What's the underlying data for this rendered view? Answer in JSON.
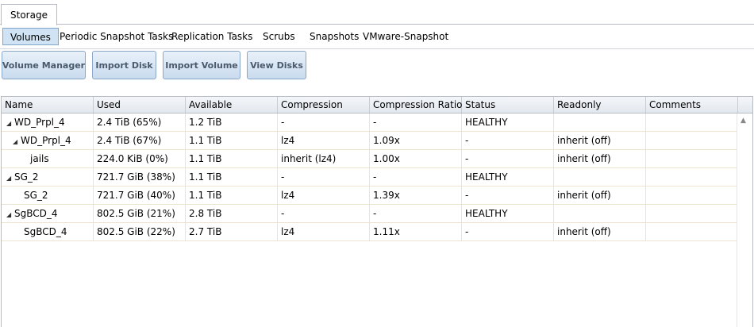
{
  "top_tab": "Storage",
  "subtabs": [
    "Volumes",
    "Periodic Snapshot Tasks",
    "Replication Tasks",
    "Scrubs",
    "Snapshots",
    "VMware-Snapshot"
  ],
  "buttons": [
    "Volume Manager",
    "Import Disk",
    "Import Volume",
    "View Disks"
  ],
  "columns": [
    "Name",
    "Used",
    "Available",
    "Compression",
    "Compression Ratio",
    "Status",
    "Readonly",
    "Comments"
  ],
  "rows": [
    {
      "name": "WD_Prpl_4",
      "used": "2.4 TiB (65%)",
      "available": "1.2 TiB",
      "compression": "-",
      "ratio": "-",
      "status": "HEALTHY",
      "readonly": "",
      "comments": ""
    },
    {
      "name": "WD_Prpl_4",
      "used": "2.4 TiB (67%)",
      "available": "1.1 TiB",
      "compression": "lz4",
      "ratio": "1.09x",
      "status": "-",
      "readonly": "inherit (off)",
      "comments": ""
    },
    {
      "name": "jails",
      "used": "224.0 KiB (0%)",
      "available": "1.1 TiB",
      "compression": "inherit (lz4)",
      "ratio": "1.00x",
      "status": "-",
      "readonly": "inherit (off)",
      "comments": ""
    },
    {
      "name": "SG_2",
      "used": "721.7 GiB (38%)",
      "available": "1.1 TiB",
      "compression": "-",
      "ratio": "-",
      "status": "HEALTHY",
      "readonly": "",
      "comments": ""
    },
    {
      "name": "SG_2",
      "used": "721.7 GiB (40%)",
      "available": "1.1 TiB",
      "compression": "lz4",
      "ratio": "1.39x",
      "status": "-",
      "readonly": "inherit (off)",
      "comments": ""
    },
    {
      "name": "SgBCD_4",
      "used": "802.5 GiB (21%)",
      "available": "2.8 TiB",
      "compression": "-",
      "ratio": "-",
      "status": "HEALTHY",
      "readonly": "",
      "comments": ""
    },
    {
      "name": "SgBCD_4",
      "used": "802.5 GiB (22%)",
      "available": "2.7 TiB",
      "compression": "lz4",
      "ratio": "1.11x",
      "status": "-",
      "readonly": "inherit (off)",
      "comments": ""
    }
  ],
  "icons": {
    "expand": "triangle-down-icon",
    "scroll_up": "scroll-up-arrow-icon"
  }
}
